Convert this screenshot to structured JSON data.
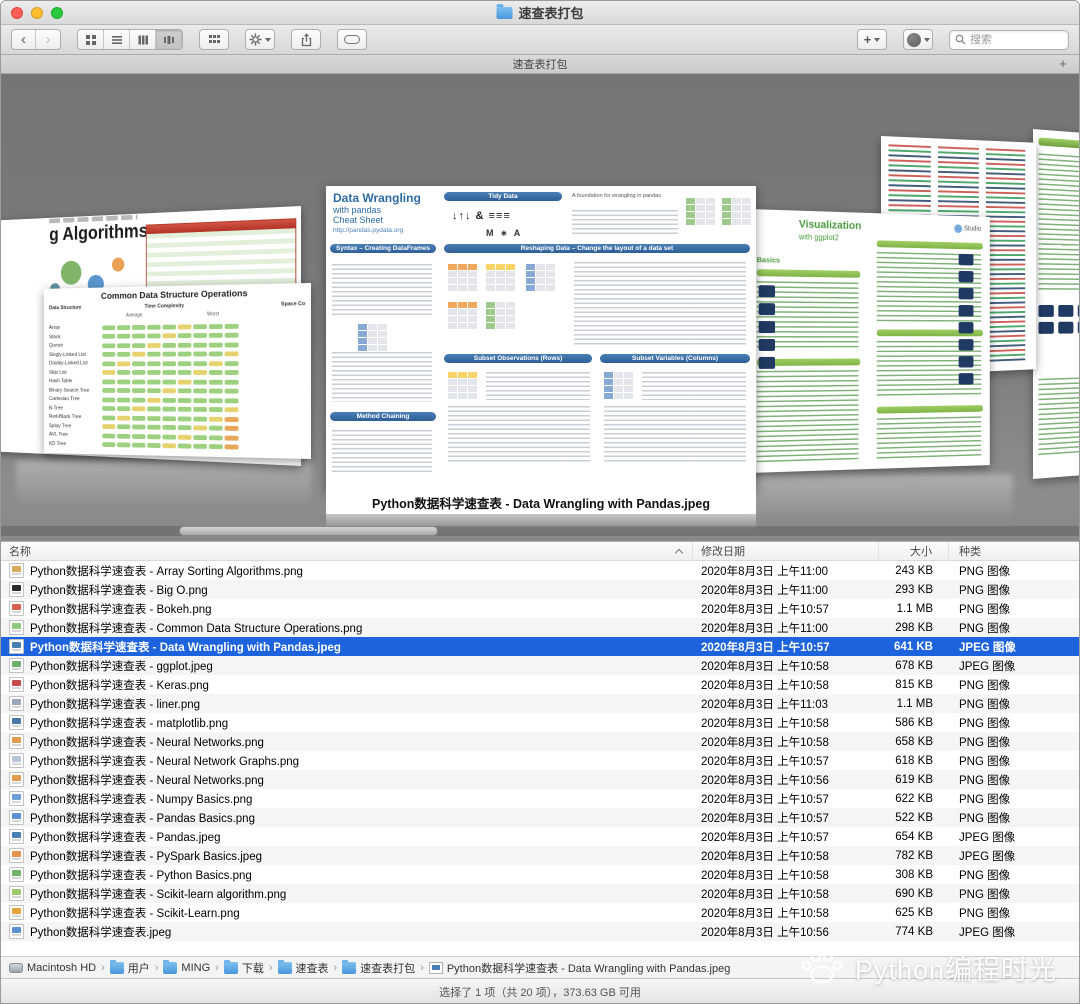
{
  "window": {
    "title": "速查表打包",
    "tab_label": "速查表打包",
    "new_tab_label": "+"
  },
  "toolbar": {
    "back_glyph": "‹",
    "forward_glyph": "›",
    "plus_label": "+",
    "search_placeholder": "搜索"
  },
  "coverflow": {
    "caption": "Python数据科学速查表 - Data Wrangling with Pandas.jpeg",
    "center": {
      "title_line1": "Data Wrangling",
      "title_line2": "with pandas",
      "title_line3": "Cheat Sheet",
      "url": "http://pandas.pydata.org",
      "tidy_header": "Tidy Data",
      "tidy_note": "A foundation for wrangling in pandas",
      "tidy_mark": "M ∗ A",
      "syntax_header": "Syntax – Creating DataFrames",
      "reshape_header": "Reshaping Data – Change the layout of a data set",
      "rows_header": "Subset Observations (Rows)",
      "cols_header": "Subset Variables (Columns)",
      "method_header": "Method Chaining"
    },
    "left": {
      "title": "Common Data Structure Operations",
      "col_structure": "Data Structure",
      "col_time": "Time Complexity",
      "col_space": "Space Co",
      "col_avg": "Average",
      "col_worst": "Worst",
      "structures": [
        "Array",
        "Stack",
        "Queue",
        "Singly-Linked List",
        "Doubly-Linked List",
        "Skip List",
        "Hash Table",
        "Binary Search Tree",
        "Cartesian Tree",
        "B-Tree",
        "Red-Black Tree",
        "Splay Tree",
        "AVL Tree",
        "KD Tree"
      ]
    },
    "far_left": {
      "title": "g Algorithms"
    },
    "right": {
      "title_line1": "Visualization",
      "title_line2": "with ggplot2",
      "basics_label": "Basics",
      "studio_label": "Studio"
    }
  },
  "list": {
    "columns": [
      "名称",
      "修改日期",
      "大小",
      "种类"
    ],
    "rows": [
      {
        "name": "Python数据科学速查表 - Array Sorting Algorithms.png",
        "date": "2020年8月3日 上午11:00",
        "size": "243 KB",
        "kind": "PNG 图像",
        "accent": "#d9a85a",
        "selected": false
      },
      {
        "name": "Python数据科学速查表 - Big O.png",
        "date": "2020年8月3日 上午11:00",
        "size": "293 KB",
        "kind": "PNG 图像",
        "accent": "#2b2b2b",
        "selected": false
      },
      {
        "name": "Python数据科学速查表 - Bokeh.png",
        "date": "2020年8月3日 上午10:57",
        "size": "1.1 MB",
        "kind": "PNG 图像",
        "accent": "#d95f50",
        "selected": false
      },
      {
        "name": "Python数据科学速查表 - Common Data Structure Operations.png",
        "date": "2020年8月3日 上午11:00",
        "size": "298 KB",
        "kind": "PNG 图像",
        "accent": "#8fc97e",
        "selected": false
      },
      {
        "name": "Python数据科学速查表 - Data Wrangling with Pandas.jpeg",
        "date": "2020年8月3日 上午10:57",
        "size": "641 KB",
        "kind": "JPEG 图像",
        "accent": "#4a7fb5",
        "selected": true
      },
      {
        "name": "Python数据科学速查表 - ggplot.jpeg",
        "date": "2020年8月3日 上午10:58",
        "size": "678 KB",
        "kind": "JPEG 图像",
        "accent": "#6fae6f",
        "selected": false
      },
      {
        "name": "Python数据科学速查表 - Keras.png",
        "date": "2020年8月3日 上午10:58",
        "size": "815 KB",
        "kind": "PNG 图像",
        "accent": "#c84b4b",
        "selected": false
      },
      {
        "name": "Python数据科学速查表 - liner.png",
        "date": "2020年8月3日 上午11:03",
        "size": "1.1 MB",
        "kind": "PNG 图像",
        "accent": "#9aa7b8",
        "selected": false
      },
      {
        "name": "Python数据科学速查表 - matplotlib.png",
        "date": "2020年8月3日 上午10:58",
        "size": "586 KB",
        "kind": "PNG 图像",
        "accent": "#4878a8",
        "selected": false
      },
      {
        "name": "Python数据科学速查表 - Neural Networks.png",
        "date": "2020年8月3日 上午10:58",
        "size": "658 KB",
        "kind": "PNG 图像",
        "accent": "#e09c4e",
        "selected": false
      },
      {
        "name": "Python数据科学速查表 - Neural Network Graphs.png",
        "date": "2020年8月3日 上午10:57",
        "size": "618 KB",
        "kind": "PNG 图像",
        "accent": "#b8c4d8",
        "selected": false
      },
      {
        "name": "Python数据科学速查表 - Neural Networks.png",
        "date": "2020年8月3日 上午10:56",
        "size": "619 KB",
        "kind": "PNG 图像",
        "accent": "#e09c4e",
        "selected": false
      },
      {
        "name": "Python数据科学速查表 - Numpy Basics.png",
        "date": "2020年8月3日 上午10:57",
        "size": "622 KB",
        "kind": "PNG 图像",
        "accent": "#6f9fd8",
        "selected": false
      },
      {
        "name": "Python数据科学速查表 - Pandas Basics.png",
        "date": "2020年8月3日 上午10:57",
        "size": "522 KB",
        "kind": "PNG 图像",
        "accent": "#5b8fd4",
        "selected": false
      },
      {
        "name": "Python数据科学速查表 - Pandas.jpeg",
        "date": "2020年8月3日 上午10:57",
        "size": "654 KB",
        "kind": "JPEG 图像",
        "accent": "#4a7fb5",
        "selected": false
      },
      {
        "name": "Python数据科学速查表 - PySpark Basics.jpeg",
        "date": "2020年8月3日 上午10:58",
        "size": "782 KB",
        "kind": "JPEG 图像",
        "accent": "#e8934a",
        "selected": false
      },
      {
        "name": "Python数据科学速查表 - Python Basics.png",
        "date": "2020年8月3日 上午10:58",
        "size": "308 KB",
        "kind": "PNG 图像",
        "accent": "#72b36a",
        "selected": false
      },
      {
        "name": "Python数据科学速查表 - Scikit-learn algorithm.png",
        "date": "2020年8月3日 上午10:58",
        "size": "690 KB",
        "kind": "PNG 图像",
        "accent": "#9fc86f",
        "selected": false
      },
      {
        "name": "Python数据科学速查表 - Scikit-Learn.png",
        "date": "2020年8月3日 上午10:58",
        "size": "625 KB",
        "kind": "PNG 图像",
        "accent": "#e8a23d",
        "selected": false
      },
      {
        "name": "Python数据科学速查表.jpeg",
        "date": "2020年8月3日 上午10:56",
        "size": "774 KB",
        "kind": "JPEG 图像",
        "accent": "#5b8fd4",
        "selected": false
      }
    ]
  },
  "pathbar": {
    "separator": "›",
    "items": [
      {
        "label": "Macintosh HD",
        "icon": "disk"
      },
      {
        "label": "用户",
        "icon": "folder"
      },
      {
        "label": "MING",
        "icon": "folder"
      },
      {
        "label": "下载",
        "icon": "folder"
      },
      {
        "label": "速查表",
        "icon": "folder"
      },
      {
        "label": "速查表打包",
        "icon": "folder"
      },
      {
        "label": "Python数据科学速查表 - Data Wrangling with Pandas.jpeg",
        "icon": "image"
      }
    ]
  },
  "statusbar": {
    "text": "选择了 1 项（共 20 项），373.63 GB 可用"
  },
  "watermark": {
    "text": "Python编程时光"
  }
}
